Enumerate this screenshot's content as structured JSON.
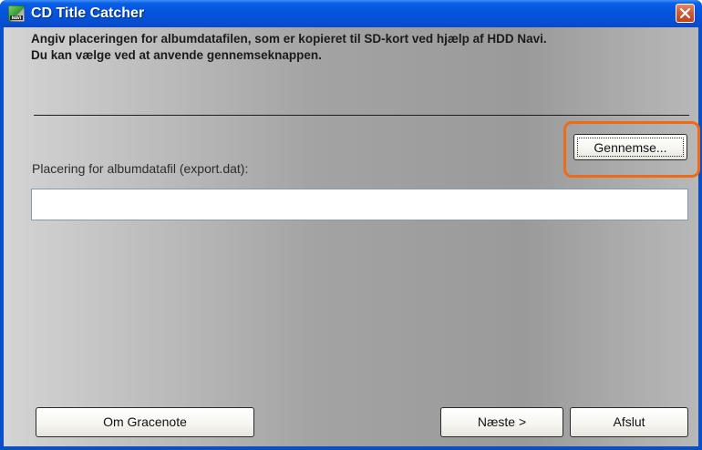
{
  "window": {
    "title": "CD Title Catcher",
    "app_icon_text": "NAVI"
  },
  "instructions": {
    "line1": "Angiv placeringen for albumdatafilen, som er kopieret til SD-kort ved hjælp af HDD Navi.",
    "line2": "Du kan vælge ved at anvende gennemseknappen."
  },
  "browse": {
    "label": "Gennemse...",
    "highlight_color": "#ef6a13"
  },
  "location_field": {
    "label": "Placering for albumdatafil (export.dat):",
    "value": "",
    "placeholder": ""
  },
  "footer": {
    "gracenote_label": "Om Gracenote",
    "next_label": "Næste >",
    "quit_label": "Afslut"
  },
  "icons": {
    "app": "cd-title-catcher-app-icon",
    "close": "close-icon"
  },
  "colors": {
    "titlebar": "#0554de",
    "close_button": "#d45a33",
    "highlight": "#ef6a13"
  }
}
